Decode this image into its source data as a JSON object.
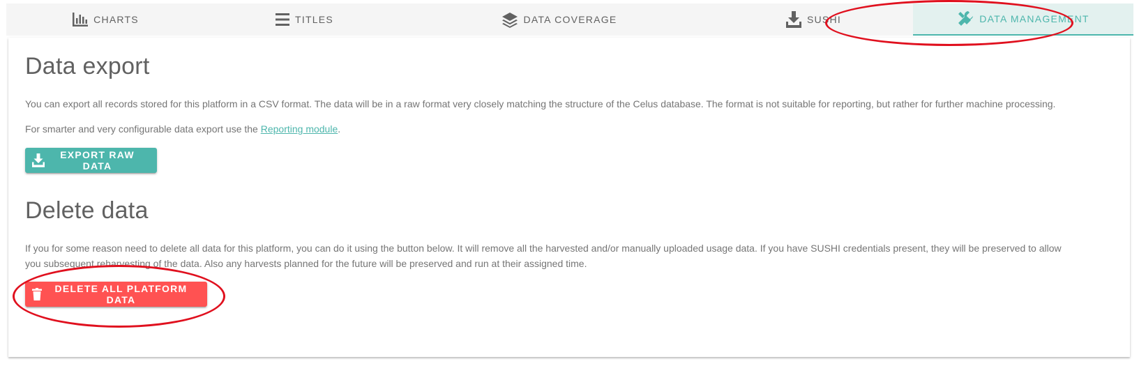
{
  "tabs": [
    {
      "label": "Charts",
      "icon": "bar-chart-icon",
      "active": false
    },
    {
      "label": "Titles",
      "icon": "list-icon",
      "active": false
    },
    {
      "label": "Data coverage",
      "icon": "layers-icon",
      "active": false
    },
    {
      "label": "Sushi",
      "icon": "download-icon",
      "active": false
    },
    {
      "label": "Data management",
      "icon": "tools-icon",
      "active": true
    }
  ],
  "export": {
    "heading": "Data export",
    "description": "You can export all records stored for this platform in a CSV format. The data will be in a raw format very closely matching the structure of the Celus database. The format is not suitable for reporting, but rather for further machine processing.",
    "smart_prefix": "For smarter and very configurable data export use the ",
    "smart_link": "Reporting module",
    "smart_suffix": ".",
    "button_label": "Export raw data",
    "button_icon": "download-icon"
  },
  "delete": {
    "heading": "Delete data",
    "description": "If you for some reason need to delete all data for this platform, you can do it using the button below. It will remove all the harvested and/or manually uploaded usage data. If you have SUSHI credentials present, they will be preserved to allow you subsequent reharvesting of the data. Also any harvests planned for the future will be preserved and run at their assigned time.",
    "button_label": "Delete all platform data",
    "button_icon": "trash-icon"
  },
  "colors": {
    "accent": "#4db6ac",
    "danger": "#ff5252",
    "annotation": "#e0101e"
  }
}
